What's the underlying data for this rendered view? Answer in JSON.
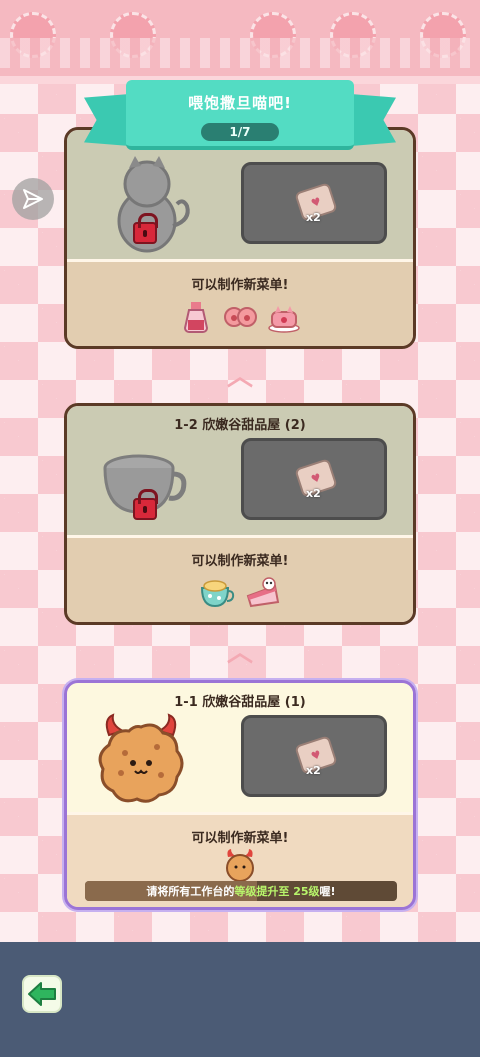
{
  "header": {
    "title": "喂饱撒旦喵吧!",
    "progress": "1/7"
  },
  "cards": [
    {
      "title": "",
      "status": "locked",
      "reward_count": "x2",
      "unlock_text": "可以制作新菜单!",
      "menu_icons": [
        "potion-bottle-icon",
        "paw-cookies-icon",
        "cat-cake-icon"
      ]
    },
    {
      "title": "1-2 欣嫩谷甜品屋 (2)",
      "status": "locked",
      "reward_count": "x2",
      "unlock_text": "可以制作新菜单!",
      "menu_icons": [
        "teacup-dessert-icon",
        "cake-slice-icon"
      ]
    },
    {
      "title": "1-1 欣嫩谷甜品屋 (1)",
      "status": "active",
      "reward_count": "x2",
      "unlock_text": "可以制作新菜单!",
      "menu_icons": [
        "devil-cookie-icon"
      ],
      "requirement": {
        "prefix": "请将所有工作台的",
        "highlight": "等级提升至 25级",
        "suffix": "喔!",
        "progress": 0.55
      }
    }
  ],
  "colors": {
    "ribbon": "#53dcc3",
    "card_border": "#5b3a26",
    "active_border": "#9b74d6",
    "bottom_bar": "#4b5b75",
    "back_arrow": "#2fb55e"
  }
}
